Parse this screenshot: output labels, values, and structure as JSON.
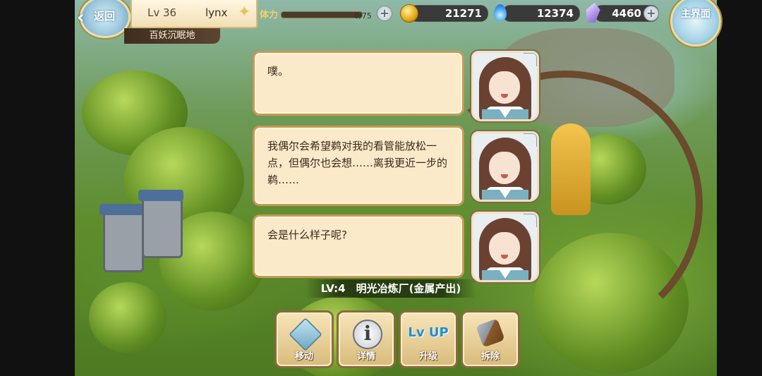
{
  "hud": {
    "back_label": "返回",
    "back_icon": "chevron-left-icon",
    "level": "Lv 36",
    "player_name": "lynx",
    "location": "百妖沉眠地",
    "stamina_label": "体力",
    "stamina_value": "0/75",
    "stamina_fraction": 0.0,
    "gold": "21271",
    "spirit": "12374",
    "crystal": "4460",
    "main_menu_label": "主界面"
  },
  "dialogue": [
    {
      "text": "噗。"
    },
    {
      "text": "我偶尔会希望鹈对我的看管能放松一点，但偶尔也会想……离我更近一步的鹈……"
    },
    {
      "text": "会是什么样子呢?"
    }
  ],
  "building": {
    "name": "LV:4　明光冶炼厂(金属产出)"
  },
  "actions": [
    {
      "label": "移动",
      "icon": "move-cube-icon"
    },
    {
      "label": "详情",
      "icon": "info-icon"
    },
    {
      "label": "升级",
      "icon": "level-up-icon",
      "icon_text": "Lv UP"
    },
    {
      "label": "拆除",
      "icon": "demolish-hammer-icon"
    }
  ],
  "colors": {
    "bubble_bg": "#fbeac9",
    "bubble_border": "#c79a57",
    "gold": "#e4a714",
    "spirit": "#3da2f0",
    "crystal": "#b79cf0"
  }
}
